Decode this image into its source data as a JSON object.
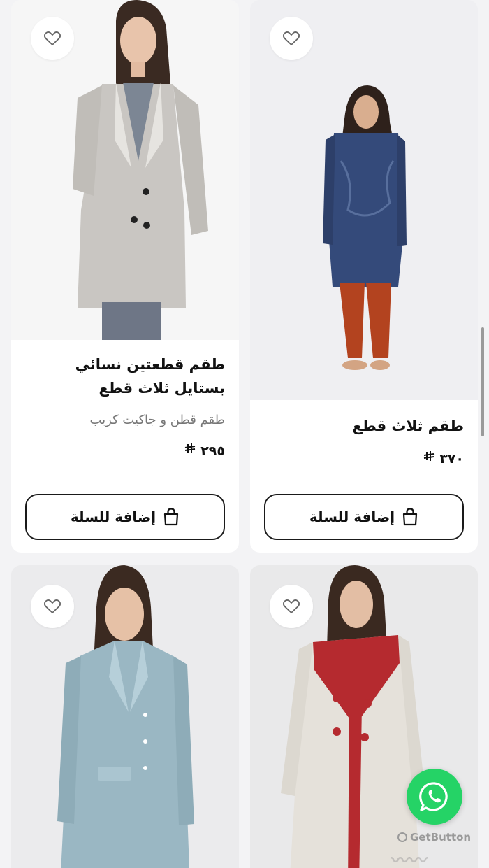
{
  "products": [
    {
      "title": "طقم قطعتين نسائي بستايل ثلاث قطع",
      "subtitle": "طقم قطن و جاكيت كريب",
      "price": "٢٩٥",
      "cart_label": "إضافة للسلة",
      "image": "model-grey-coat"
    },
    {
      "title": "طقم ثلاث قطع",
      "price": "٣٧٠",
      "cart_label": "إضافة للسلة",
      "image": "model-navy-print-tunic"
    },
    {
      "image": "model-light-blue-coat"
    },
    {
      "image": "model-cream-red-coat"
    }
  ],
  "currency_symbol": "ريال",
  "icons": [
    "heart-icon",
    "bag-icon",
    "whatsapp-icon"
  ],
  "widget": {
    "brand": "GetButton"
  },
  "colors": {
    "whatsapp": "#25d366",
    "text": "#111111",
    "muted": "#777777"
  }
}
